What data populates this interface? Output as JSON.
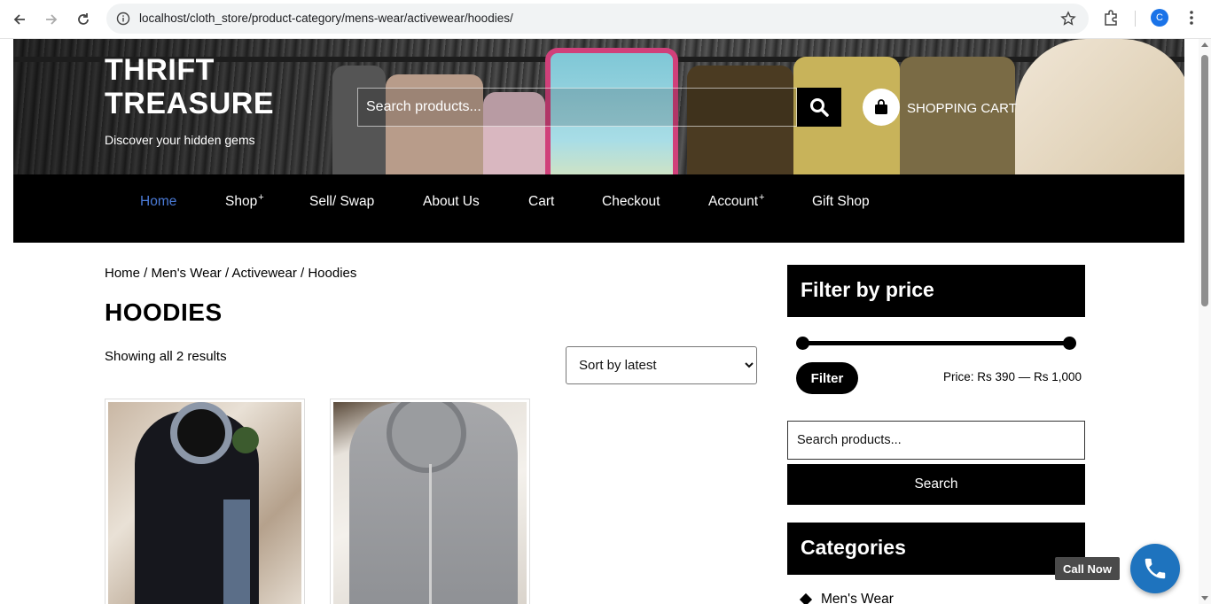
{
  "browser": {
    "url": "localhost/cloth_store/product-category/mens-wear/activewear/hoodies/",
    "profile_initial": "C"
  },
  "header": {
    "site_title_line1": "THRIFT",
    "site_title_line2": "TREASURE",
    "tagline": "Discover your hidden gems",
    "search_placeholder": "Search products...",
    "cart_label": "SHOPPING CART"
  },
  "nav": {
    "items": [
      {
        "label": "Home",
        "active": true,
        "has_sub": false
      },
      {
        "label": "Shop",
        "active": false,
        "has_sub": true
      },
      {
        "label": "Sell/ Swap",
        "active": false,
        "has_sub": false
      },
      {
        "label": "About Us",
        "active": false,
        "has_sub": false
      },
      {
        "label": "Cart",
        "active": false,
        "has_sub": false
      },
      {
        "label": "Checkout",
        "active": false,
        "has_sub": false
      },
      {
        "label": "Account",
        "active": false,
        "has_sub": true
      },
      {
        "label": "Gift Shop",
        "active": false,
        "has_sub": false
      }
    ],
    "plus": "+",
    "active_color": "#4a7ad6"
  },
  "content": {
    "breadcrumb": "Home / Men's Wear / Activewear / Hoodies",
    "title": "HOODIES",
    "result_count": "Showing all 2 results",
    "sort_selected": "Sort by latest"
  },
  "sidebar": {
    "filter_title": "Filter by price",
    "filter_button": "Filter",
    "price_label": "Price: Rs 390 — Rs 1,000",
    "search_placeholder": "Search products...",
    "search_button": "Search",
    "categories_title": "Categories",
    "categories": [
      "Men's Wear"
    ]
  },
  "callnow": {
    "label": "Call Now"
  },
  "colors": {
    "primary": "#000000",
    "link_active": "#4a7ad6",
    "call_button": "#1e73be"
  }
}
